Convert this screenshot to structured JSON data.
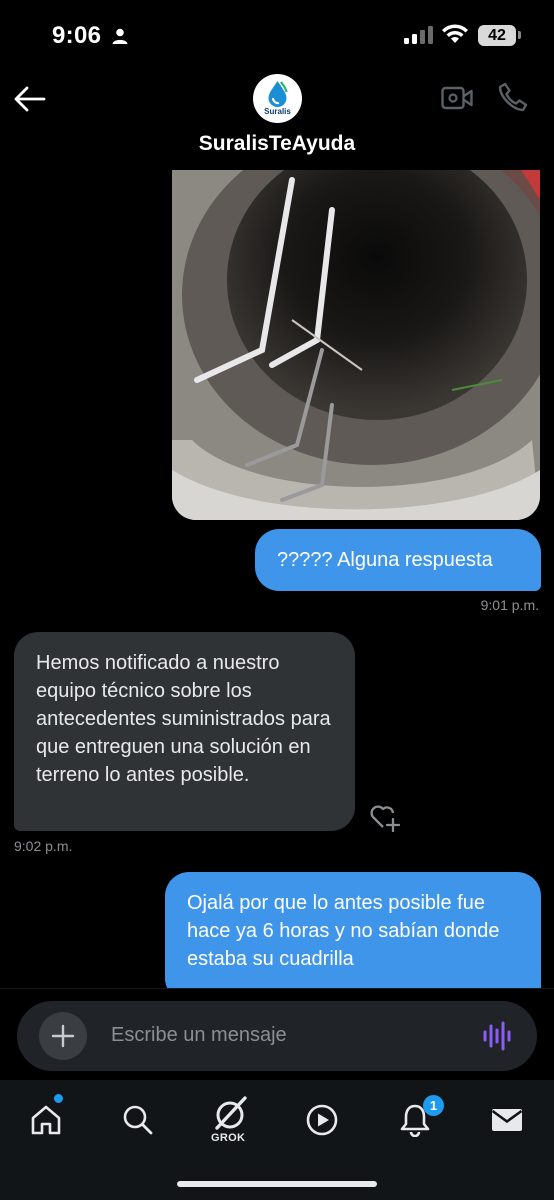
{
  "status_bar": {
    "time": "9:06",
    "battery": "42"
  },
  "header": {
    "title": "SuralisTeAyuda",
    "avatar_brand": "Suralis"
  },
  "messages": [
    {
      "direction": "out",
      "text": "????? Alguna respuesta",
      "time": "9:01 p.m."
    },
    {
      "direction": "in",
      "text": "Hemos notificado a nuestro equipo técnico sobre los antecedentes suministrados para que entreguen una solución en terreno lo antes posible.",
      "time": "9:02 p.m."
    },
    {
      "direction": "out",
      "text": "Ojalá por que lo antes posible fue hace ya 6 horas y no sabían donde estaba su cuadrilla"
    }
  ],
  "composer": {
    "placeholder": "Escribe un mensaje"
  },
  "nav": {
    "grok_label": "GROK",
    "notifications_badge": "1"
  },
  "colors": {
    "outgoing_bubble": "#3f95e9",
    "incoming_bubble": "#2f3336",
    "accent": "#1d9bf0",
    "voice_icon": "#8b5cf6"
  }
}
